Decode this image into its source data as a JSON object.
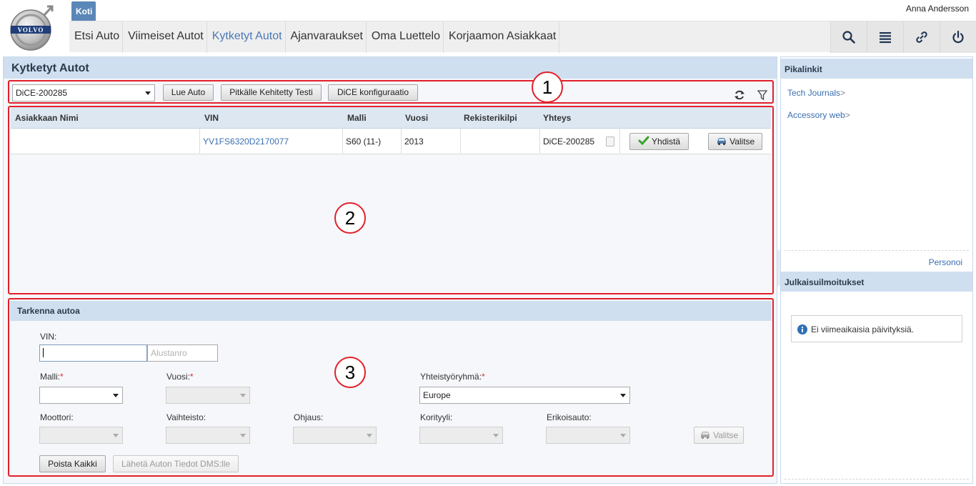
{
  "header": {
    "home_tab": "Koti",
    "user_name": "Anna Andersson",
    "nav": [
      "Etsi Auto",
      "Viimeiset Autot",
      "Kytketyt Autot",
      "Ajanvaraukset",
      "Oma Luettelo",
      "Korjaamon Asiakkaat"
    ],
    "active_nav": "Kytketyt Autot",
    "actions": [
      "search-icon",
      "list-icon",
      "link-icon",
      "power-icon"
    ]
  },
  "main": {
    "title": "Kytketyt Autot",
    "toolbar": {
      "device_selected": "DiCE-200285",
      "btn_read_car": "Lue Auto",
      "btn_extended_test": "Pitkälle Kehitetty Testi",
      "btn_dice_config": "DiCE konfiguraatio",
      "icons": [
        "refresh-icon",
        "filter-icon"
      ]
    },
    "grid": {
      "columns": [
        "Asiakkaan Nimi",
        "VIN",
        "Malli",
        "Vuosi",
        "Rekisterikilpi",
        "Yhteys"
      ],
      "rows": [
        {
          "customer": "",
          "vin": "YV1FS6320D2170077",
          "model": "S60 (11-)",
          "year": "2013",
          "plate": "",
          "connection": "DiCE-200285",
          "connect_label": "Yhdistä",
          "select_label": "Valitse"
        }
      ]
    },
    "refine": {
      "title": "Tarkenna autoa",
      "vin_label": "VIN:",
      "vin_value": "",
      "vin_suffix_placeholder": "Alustanro",
      "model_label": "Malli:",
      "year_label": "Vuosi:",
      "partner_group_label": "Yhteistyöryhmä:",
      "partner_group_value": "Europe",
      "engine_label": "Moottori:",
      "gearbox_label": "Vaihteisto:",
      "steering_label": "Ohjaus:",
      "body_label": "Korityyli:",
      "special_label": "Erikoisauto:",
      "select_label": "Valitse",
      "clear_all_label": "Poista Kaikki",
      "send_dms_label": "Lähetä Auton Tiedot DMS:lle",
      "required_marker": "*"
    },
    "annotations": [
      "1",
      "2",
      "3"
    ]
  },
  "sidebar": {
    "quicklinks_title": "Pikalinkit",
    "links": [
      "Tech Journals",
      "Accessory web"
    ],
    "link_arrow": ">",
    "personalize": "Personoi",
    "release_title": "Julkaisuilmoitukset",
    "release_notice": "Ei viimeaikaisia päivityksiä."
  },
  "colors": {
    "accent": "#4a78b5",
    "panel_header": "#cfdff0",
    "annotation_red": "#e3202a",
    "home_tab": "#5b87b8"
  }
}
